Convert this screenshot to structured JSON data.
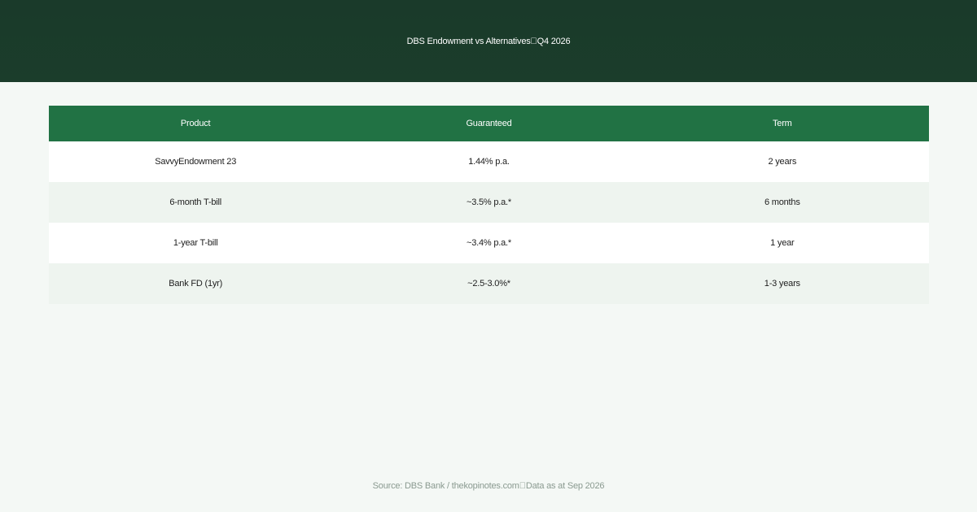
{
  "header": {
    "title": "DBS Endowment vs Alternatives\u0000Q4 2026"
  },
  "table": {
    "columns": [
      "Product",
      "Guaranteed",
      "Term"
    ],
    "rows": [
      [
        "SavvyEndowment 23",
        "1.44% p.a.",
        "2 years"
      ],
      [
        "6-month T-bill",
        "~3.5% p.a.*",
        "6 months"
      ],
      [
        "1-year T-bill",
        "~3.4% p.a.*",
        "1 year"
      ],
      [
        "Bank FD (1yr)",
        "~2.5-3.0%*",
        "1-3 years"
      ]
    ]
  },
  "footer": {
    "source": "Source: DBS Bank / thekopinotes.com\u0000Data as at Sep 2026"
  },
  "colors": {
    "header_bg": "#1b3d2b",
    "table_header_bg": "#217244",
    "page_bg": "#f4f8f5",
    "row_alt_bg": "#eef4ef"
  }
}
